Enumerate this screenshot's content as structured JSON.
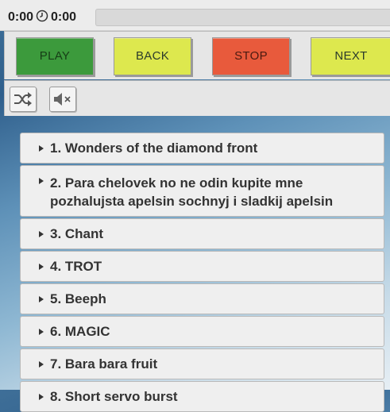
{
  "player": {
    "current_time": "0:00",
    "total_time": "0:00",
    "progress": 0
  },
  "controls": {
    "play_label": "PLAY",
    "back_label": "BACK",
    "stop_label": "STOP",
    "next_label": "NEXT",
    "play_color": "#3c9a3c",
    "back_color": "#dde84e",
    "stop_color": "#e85a3c",
    "next_color": "#dde84e"
  },
  "options": {
    "shuffle_icon": "shuffle-icon",
    "mute_icon": "speaker-muted-icon"
  },
  "playlist": {
    "tracks": [
      "1. Wonders of the diamond front",
      "2. Para chelovek no ne odin kupite mne pozhalujsta apelsin sochnyj i sladkij apelsin",
      "3. Chant",
      "4. TROT",
      "5. Beeph",
      "6. MAGIC",
      "7. Bara bara fruit",
      "8. Short servo burst"
    ]
  }
}
